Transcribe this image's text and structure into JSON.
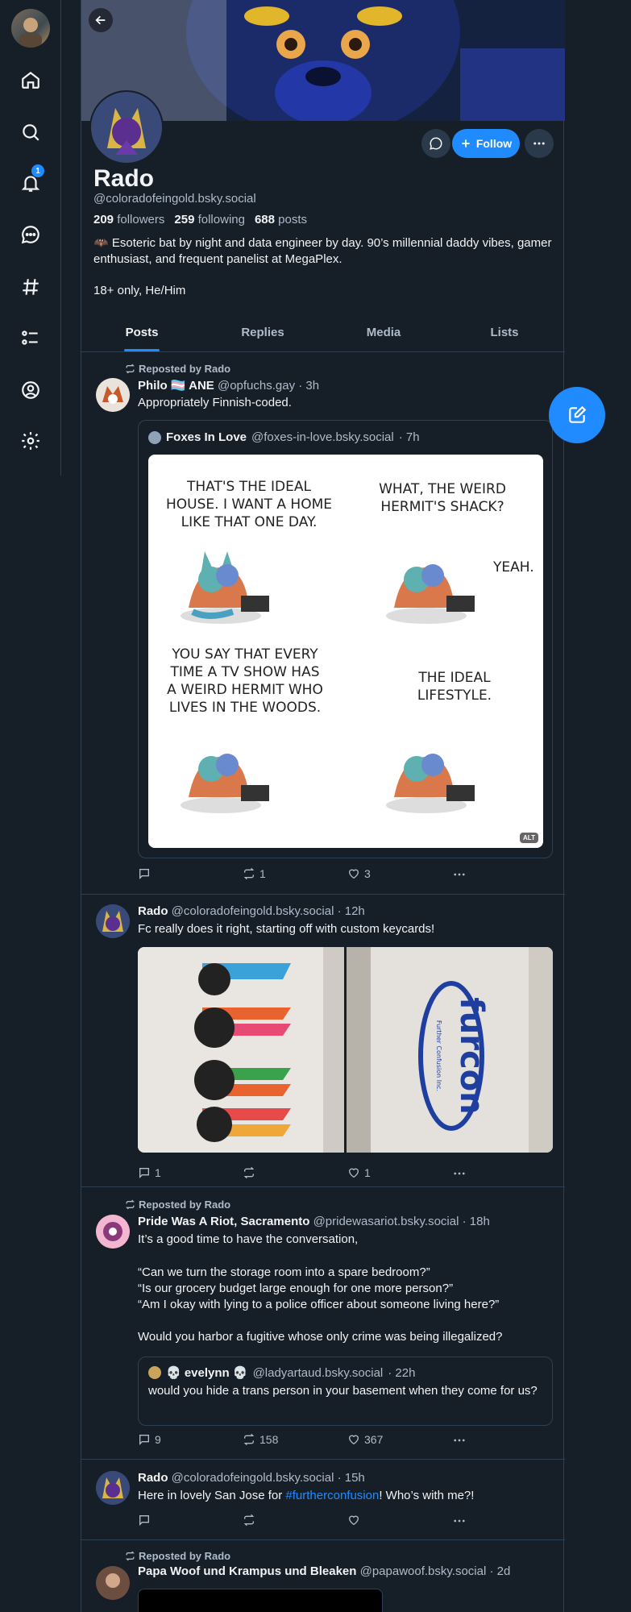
{
  "nav": {
    "notifications_badge": "1"
  },
  "profile": {
    "name": "Rado",
    "handle": "@coloradofeingold.bsky.social",
    "followers_count": "209",
    "followers_label": "followers",
    "following_count": "259",
    "following_label": "following",
    "posts_count": "688",
    "posts_label": "posts",
    "bio_line1": "🦇 Esoteric bat by night and data engineer by day. 90’s millennial daddy vibes, gamer enthusiast, and frequent panelist at MegaPlex.",
    "bio_line2": "18+ only, He/Him",
    "follow_label": "Follow"
  },
  "tabs": [
    "Posts",
    "Replies",
    "Media",
    "Lists"
  ],
  "posts": [
    {
      "repost_label": "Reposted by Rado",
      "author": "Philo 🏳️‍⚧️ ANE",
      "handle": "@opfuchs.gay",
      "time": "· 3h",
      "text": "Appropriately Finnish-coded.",
      "quote_author": "Foxes In Love",
      "quote_handle": "@foxes-in-love.bsky.social",
      "quote_time": "· 7h",
      "comic_panels": [
        "THAT'S THE IDEAL HOUSE. I WANT A HOME LIKE THAT ONE DAY.",
        "WHAT, THE WEIRD HERMIT'S SHACK?",
        "YEAH.",
        "YOU SAY THAT EVERY TIME A TV SHOW HAS A WEIRD HERMIT WHO LIVES IN THE WOODS.",
        "THE IDEAL LIFESTYLE."
      ],
      "alt": "ALT",
      "replies": "",
      "reposts": "1",
      "likes": "3"
    },
    {
      "author": "Rado",
      "handle": "@coloradofeingold.bsky.social",
      "time": "· 12h",
      "text": "Fc really does it right, starting off with custom keycards!",
      "card_text": "furcon",
      "card_sub": "Further Confusion Inc.",
      "replies": "1",
      "reposts": "",
      "likes": "1"
    },
    {
      "repost_label": "Reposted by Rado",
      "author": "Pride Was A Riot, Sacramento",
      "handle": "@pridewasariot.bsky.social",
      "time": "· 18h",
      "text1": "It’s a good time to have the conversation,",
      "text2": "“Can we turn the storage room into a spare bedroom?”",
      "text3": "“Is our grocery budget large enough for one more person?”",
      "text4": "“Am I okay with lying to a police officer about someone living here?”",
      "text5": "Would you harbor a fugitive whose only crime was being illegalized?",
      "quote_author": "💀 evelynn 💀",
      "quote_handle": "@ladyartaud.bsky.social",
      "quote_time": "· 22h",
      "quote_text": "would you hide a trans person in your basement when they come for us?",
      "replies": "9",
      "reposts": "158",
      "likes": "367"
    },
    {
      "author": "Rado",
      "handle": "@coloradofeingold.bsky.social",
      "time": "· 15h",
      "text_before": "Here in lovely San Jose for ",
      "hashtag": "#furtherconfusion",
      "text_after": "! Who’s with me?!",
      "replies": "",
      "reposts": "",
      "likes": ""
    },
    {
      "repost_label": "Reposted by Rado",
      "author": "Papa Woof und Krampus und Bleaken",
      "handle": "@papawoof.bsky.social",
      "time": "· 2d"
    }
  ],
  "colors": {
    "accent": "#208bfe",
    "bg": "#161e27",
    "border": "#2e4052",
    "muted": "#aebbc9"
  }
}
